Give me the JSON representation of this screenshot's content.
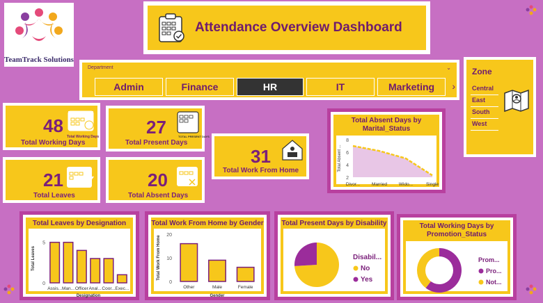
{
  "brand": {
    "name": "TeamTrack Solutions"
  },
  "header": {
    "title": "Attendance Overview Dashboard",
    "icon": "clipboard-calendar-icon"
  },
  "department": {
    "label": "Department",
    "options": [
      "Admin",
      "Finance",
      "HR",
      "IT",
      "Marketing"
    ],
    "selected": "HR"
  },
  "zone": {
    "title": "Zone",
    "options": [
      "Central",
      "East",
      "South",
      "West"
    ]
  },
  "kpis": {
    "working_days": {
      "value": "48",
      "label": "Total Working Days",
      "icon": "calendar-icon",
      "icon_caption": "Total Working Days"
    },
    "present_days": {
      "value": "27",
      "label": "Total Present Days",
      "icon": "present-days-icon",
      "icon_caption": "TOTAL PRESENT DAYS"
    },
    "work_from_home": {
      "value": "31",
      "label": "Total Work From Home",
      "icon": "home-laptop-icon"
    },
    "leaves": {
      "value": "21",
      "label": "Total Leaves",
      "icon": "calendar-chart-icon"
    },
    "absent_days": {
      "value": "20",
      "label": "Total Absent Days",
      "icon": "absent-calendar-icon"
    }
  },
  "colors": {
    "accent_yellow": "#f7c71b",
    "accent_purple": "#7a1f7a",
    "background": "#c76fc3",
    "area_fill": "#e8c6e6"
  },
  "chart_data": [
    {
      "type": "area",
      "title": "Total Absent Days by Marital_Status",
      "ylabel": "Total Absent ...",
      "xlabel": "",
      "categories": [
        "Divor...",
        "Married",
        "Wido...",
        "Single"
      ],
      "values": [
        7,
        6.2,
        5,
        2.3
      ],
      "ylim": [
        2,
        8
      ],
      "yticks": [
        "2",
        "4",
        "6",
        "8"
      ]
    },
    {
      "type": "bar",
      "title": "Total Leaves by Designation",
      "ylabel": "Total Leaves",
      "xlabel": "Designation",
      "categories": [
        "Assis...",
        "Man...",
        "Officer",
        "Anal...",
        "Coor...",
        "Exec..."
      ],
      "values": [
        5,
        5,
        4,
        3,
        3,
        1
      ],
      "ylim": [
        0,
        6
      ],
      "yticks": [
        "0",
        "5"
      ]
    },
    {
      "type": "bar",
      "title": "Total Work From Home by Gender",
      "ylabel": "Total Work From Home",
      "xlabel": "Gender",
      "categories": [
        "Other",
        "Male",
        "Female"
      ],
      "values": [
        16,
        9,
        6
      ],
      "ylim": [
        0,
        20
      ],
      "yticks": [
        "0",
        "10",
        "20"
      ]
    },
    {
      "type": "pie",
      "title": "Total Present Days by Disability",
      "legend_title": "Disabil...",
      "legend_position": "right",
      "series": [
        {
          "name": "No",
          "value": 20,
          "color": "#f7c71b"
        },
        {
          "name": "Yes",
          "value": 7,
          "color": "#9b2c9b"
        }
      ]
    },
    {
      "type": "pie",
      "title": "Total Working Days by Promotion_Status",
      "legend_title": "Prom...",
      "legend_position": "right",
      "donut": true,
      "series": [
        {
          "name": "Pro...",
          "value": 29,
          "color": "#9b2c9b"
        },
        {
          "name": "Not...",
          "value": 19,
          "color": "#f7c71b"
        }
      ]
    }
  ]
}
